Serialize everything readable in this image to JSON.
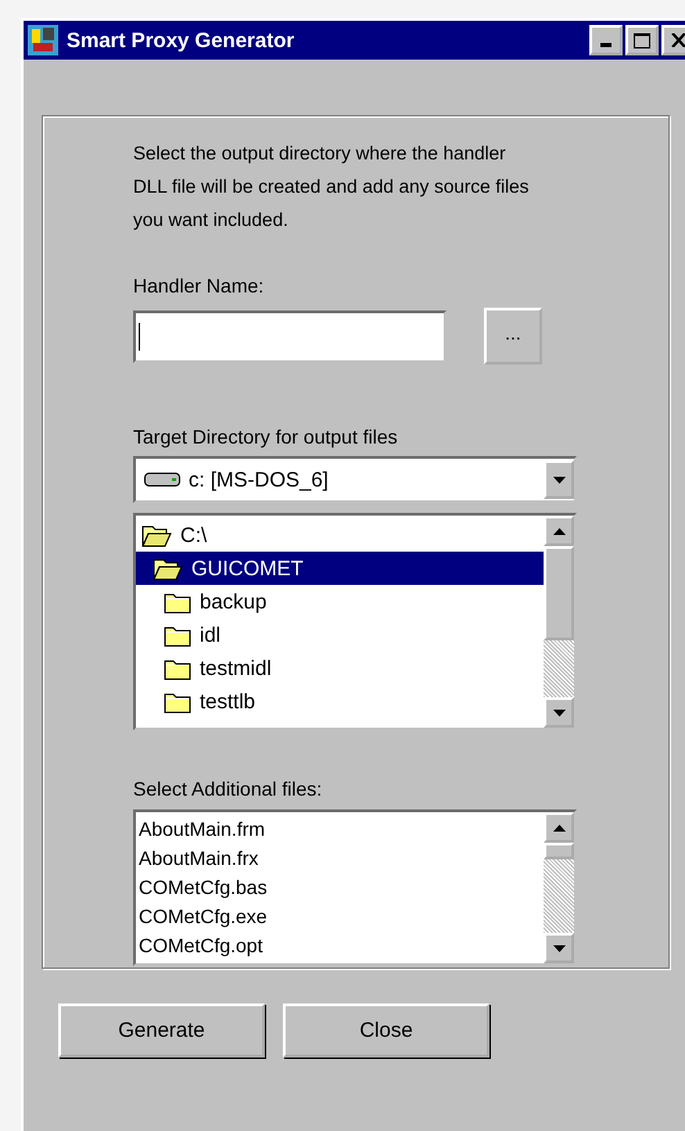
{
  "window": {
    "title": "Smart Proxy Generator"
  },
  "instructions": "Select the output directory where the handler DLL file will be created and add any source files you want included.",
  "handler_name": {
    "label": "Handler Name:",
    "browse_button": "..."
  },
  "target_directory": {
    "label": "Target Directory for output files",
    "drive": "c: [MS-DOS_6]",
    "folders": [
      {
        "name": "C:\\",
        "expanded": true,
        "selected": false,
        "children": [
          {
            "name": "GUICOMET",
            "expanded": true,
            "selected": true,
            "children": [
              {
                "name": "backup",
                "expanded": false,
                "selected": false
              },
              {
                "name": "idl",
                "expanded": false,
                "selected": false
              },
              {
                "name": "testmidl",
                "expanded": false,
                "selected": false
              },
              {
                "name": "testtlb",
                "expanded": false,
                "selected": false
              }
            ]
          }
        ]
      }
    ]
  },
  "additional_files": {
    "label": "Select Additional files:",
    "items": [
      "AboutMain.frm",
      "AboutMain.frx",
      "COMetCfg.bas",
      "COMetCfg.exe",
      "COMetCfg.opt"
    ]
  },
  "buttons": [
    "Generate",
    "Close"
  ]
}
